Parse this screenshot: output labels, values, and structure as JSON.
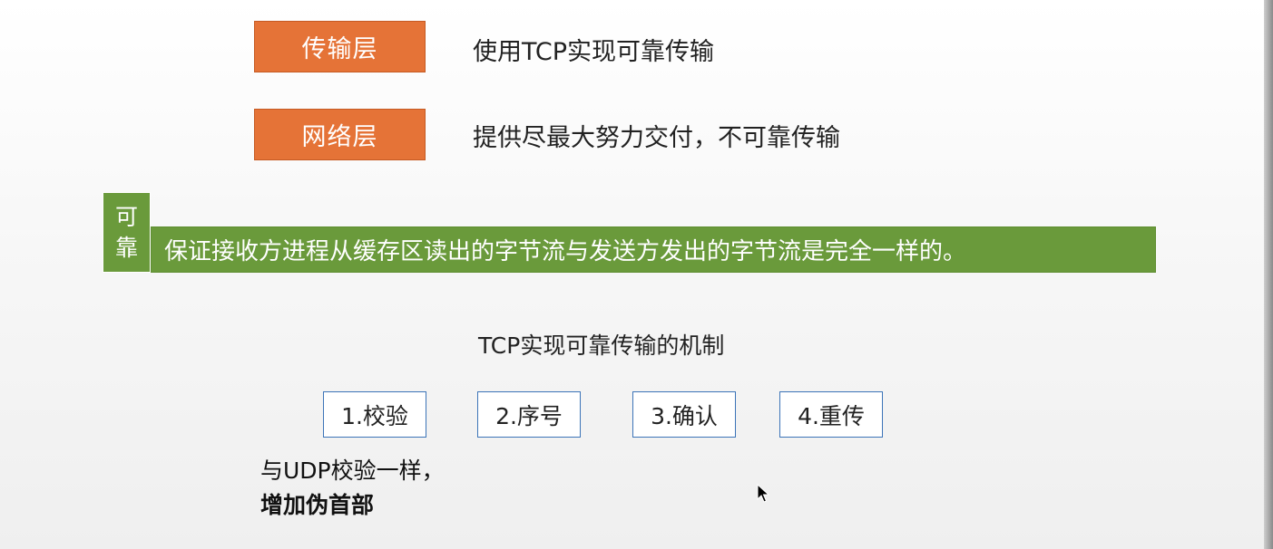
{
  "layers": [
    {
      "label": "传输层",
      "description": "使用TCP实现可靠传输"
    },
    {
      "label": "网络层",
      "description": "提供尽最大努力交付，不可靠传输"
    }
  ],
  "reliable": {
    "tag_line1": "可",
    "tag_line2": "靠",
    "definition": "保证接收方进程从缓存区读出的字节流与发送方发出的字节流是完全一样的。"
  },
  "mechanisms": {
    "title": "TCP实现可靠传输的机制",
    "items": [
      {
        "label": "1.校验"
      },
      {
        "label": "2.序号"
      },
      {
        "label": "3.确认"
      },
      {
        "label": "4.重传"
      }
    ]
  },
  "note": {
    "line1": "与UDP校验一样，",
    "line2": "增加伪首部"
  },
  "colors": {
    "layer_box": "#e57337",
    "reliable_bar": "#6a9a3b",
    "mechanism_border": "#3c74b8"
  },
  "icons": {
    "cursor": "mouse-pointer-icon"
  }
}
